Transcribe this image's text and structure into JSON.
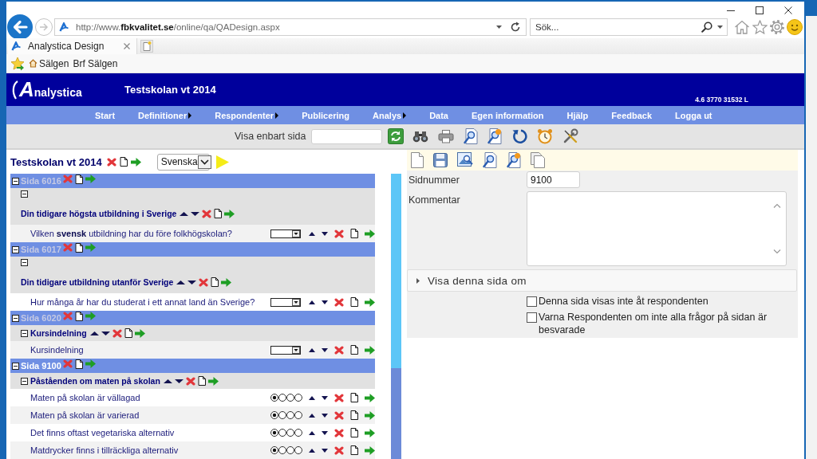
{
  "browser": {
    "address": "http://www.**fbkvalitet.se**/online/qa/QADesign.aspx",
    "search": {
      "placeholder": "Sök..."
    },
    "tabs": [
      {
        "label": "Analystica Design",
        "selected": true
      }
    ],
    "favorites": [
      {
        "label": "Sälgen",
        "kind": "home"
      },
      {
        "label": "Brf Sälgen",
        "kind": "plain"
      }
    ]
  },
  "header": {
    "logo": "Analystica",
    "title": "Testskolan vt 2014",
    "version": "4.6 3770 31532 L"
  },
  "nav": [
    {
      "label": "Start",
      "submenu": false
    },
    {
      "label": "Definitioner",
      "submenu": true
    },
    {
      "label": "Respondenter",
      "submenu": true
    },
    {
      "label": "Publicering",
      "submenu": false
    },
    {
      "label": "Analys",
      "submenu": true
    },
    {
      "label": "Data",
      "submenu": false
    },
    {
      "label": "Egen information",
      "submenu": false
    },
    {
      "label": "Hjälp",
      "submenu": false
    },
    {
      "label": "Feedback",
      "submenu": false
    },
    {
      "label": "Logga ut",
      "submenu": false
    }
  ],
  "toolbar": {
    "label": "Visa enbart sida"
  },
  "survey": {
    "title": "Testskolan vt 2014",
    "language": "Svenska",
    "pages": [
      {
        "label": "Sida 6016",
        "selected": false,
        "expanded": true,
        "groups": [
          {
            "title": "Din tidigare högsta utbildning i Sverige",
            "kind": "stacked",
            "expanded": true,
            "questions": [
              {
                "text": "Vilken **svensk** utbildning har du före folkhögskolan?",
                "kind": "dropdown"
              }
            ]
          }
        ]
      },
      {
        "label": "Sida 6017",
        "selected": false,
        "expanded": true,
        "groups": [
          {
            "title": "Din tidigare utbildning utanför Sverige",
            "kind": "stacked",
            "expanded": true,
            "questions": [
              {
                "text": "Hur många år har du studerat i ett annat land än Sverige?",
                "kind": "dropdown"
              }
            ]
          }
        ]
      },
      {
        "label": "Sida 6020",
        "selected": false,
        "expanded": true,
        "groups": [
          {
            "title": "Kursindelning",
            "kind": "inline",
            "expanded": true,
            "questions": [
              {
                "text": "Kursindelning",
                "kind": "dropdown"
              }
            ]
          }
        ]
      },
      {
        "label": "Sida 9100",
        "selected": true,
        "expanded": true,
        "groups": [
          {
            "title": "Påståenden om maten på skolan",
            "kind": "inline",
            "expanded": true,
            "questions": [
              {
                "text": "Maten på skolan är vällagad",
                "kind": "scale",
                "choices": [
                  {
                    "selected": true
                  },
                  {
                    "selected": false
                  },
                  {
                    "selected": false
                  },
                  {
                    "selected": false
                  }
                ]
              },
              {
                "text": "Maten på skolan är varierad",
                "kind": "scale",
                "choices": [
                  {
                    "selected": true
                  },
                  {
                    "selected": false
                  },
                  {
                    "selected": false
                  },
                  {
                    "selected": false
                  }
                ]
              },
              {
                "text": "Det finns oftast vegetariska alternativ",
                "kind": "scale",
                "choices": [
                  {
                    "selected": true
                  },
                  {
                    "selected": false
                  },
                  {
                    "selected": false
                  },
                  {
                    "selected": false
                  }
                ]
              },
              {
                "text": "Matdrycker finns i tillräckliga alternativ",
                "kind": "scale",
                "choices": [
                  {
                    "selected": true
                  },
                  {
                    "selected": false
                  },
                  {
                    "selected": false
                  },
                  {
                    "selected": false
                  }
                ]
              }
            ]
          }
        ]
      }
    ]
  },
  "page_form": {
    "fields": [
      {
        "label": "Sidnummer",
        "kind": "input",
        "value": "9100"
      },
      {
        "label": "Kommentar",
        "kind": "textarea"
      }
    ],
    "section": {
      "label": "Visa denna sida om",
      "expanded": false
    },
    "options": [
      {
        "label": "Denna sida visas inte åt respondenten",
        "checked": false
      },
      {
        "label": "Varna Respondenten om inte alla frågor på sidan är besvarade",
        "checked": false
      }
    ]
  }
}
